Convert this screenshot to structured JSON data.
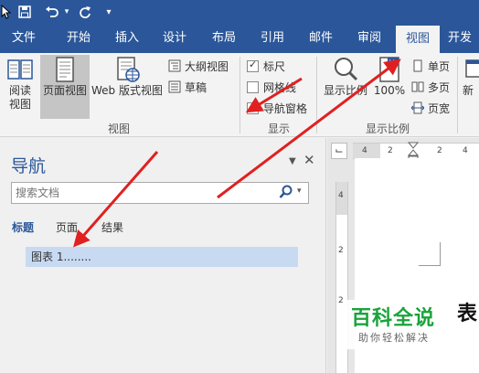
{
  "colors": {
    "accent": "#2b579a",
    "arrow": "#e02020",
    "watermark_green": "#1aa33a"
  },
  "quick_access": {
    "items": [
      "save-icon",
      "undo-icon",
      "redo-icon",
      "customize-icon"
    ]
  },
  "tabs": [
    "文件",
    "开始",
    "插入",
    "设计",
    "布局",
    "引用",
    "邮件",
    "审阅",
    "视图",
    "开发"
  ],
  "active_tab": "视图",
  "ribbon": {
    "views": {
      "read_mode": "阅读\n视图",
      "print_layout": "页面视图",
      "web_layout": "Web 版式视图",
      "outline": "大纲视图",
      "draft": "草稿",
      "group_label": "视图"
    },
    "show": {
      "ruler": "标尺",
      "gridlines": "网格线",
      "navigation_pane": "导航窗格",
      "group_label": "显示",
      "ruler_checked": true,
      "gridlines_checked": false,
      "navigation_pane_checked": true
    },
    "zoom": {
      "zoom": "显示比例",
      "hundred": "100%",
      "one_page": "单页",
      "multiple_pages": "多页",
      "page_width": "页宽",
      "group_label": "显示比例",
      "zoom_icon_label": "100"
    },
    "window": {
      "new_window": "新"
    }
  },
  "navigation": {
    "title": "导航",
    "search_placeholder": "搜索文档",
    "tabs": [
      "标题",
      "页面",
      "结果"
    ],
    "active_tab": "标题",
    "heading": "图表 1........"
  },
  "ruler": {
    "corner": "⌙",
    "h_numbers": [
      "4",
      "2",
      "2",
      "4"
    ],
    "v_numbers": [
      "4",
      "2",
      "2"
    ]
  },
  "document": {
    "visible_char": "表",
    "return_mark": "↵"
  },
  "watermark": {
    "main": "百科全说",
    "sub": "助你轻松解决"
  }
}
